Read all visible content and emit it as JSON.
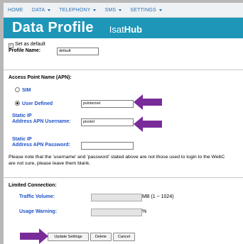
{
  "nav": {
    "home": "HOME",
    "data": "DATA",
    "telephony": "TELEPHONY",
    "sms": "SMS",
    "settings": "SETTINGS"
  },
  "banner": {
    "title": "Data Profile",
    "logo_prefix": "Isat",
    "logo_bold": "Hub"
  },
  "profile": {
    "set_default_label": "Set as default",
    "set_default_checked": true,
    "name_label": "Profile Name:",
    "name_value": "default"
  },
  "apn": {
    "heading": "Access Point Name (APN):",
    "sim_label": "SIM",
    "user_defined_label": "User Defined",
    "user_defined_value": "pvinternet",
    "username_label_line1": "Static IP",
    "username_label_line2": "Address APN Username:",
    "username_value": "pivotel",
    "password_label_line1": "Static IP",
    "password_label_line2": "Address APN Password:",
    "password_value": "",
    "note_line1": "Please note that the 'username' and 'password' stated above are not those used to login to the WebC",
    "note_line2": "are not sure, please leave them blank."
  },
  "limited": {
    "heading": "Limited Connection:",
    "traffic_label": "Traffic Volume:",
    "traffic_unit": "MB (1 ~ 1024)",
    "warning_label": "Usage Warning:",
    "warning_unit": "%"
  },
  "buttons": {
    "update": "Update Settings",
    "delete": "Delete",
    "cancel": "Cancel"
  },
  "colors": {
    "banner": "#1d96b8",
    "nav_text": "#2a6fb0",
    "label_blue": "#1f52c9",
    "arrow": "#7a2b9a"
  }
}
